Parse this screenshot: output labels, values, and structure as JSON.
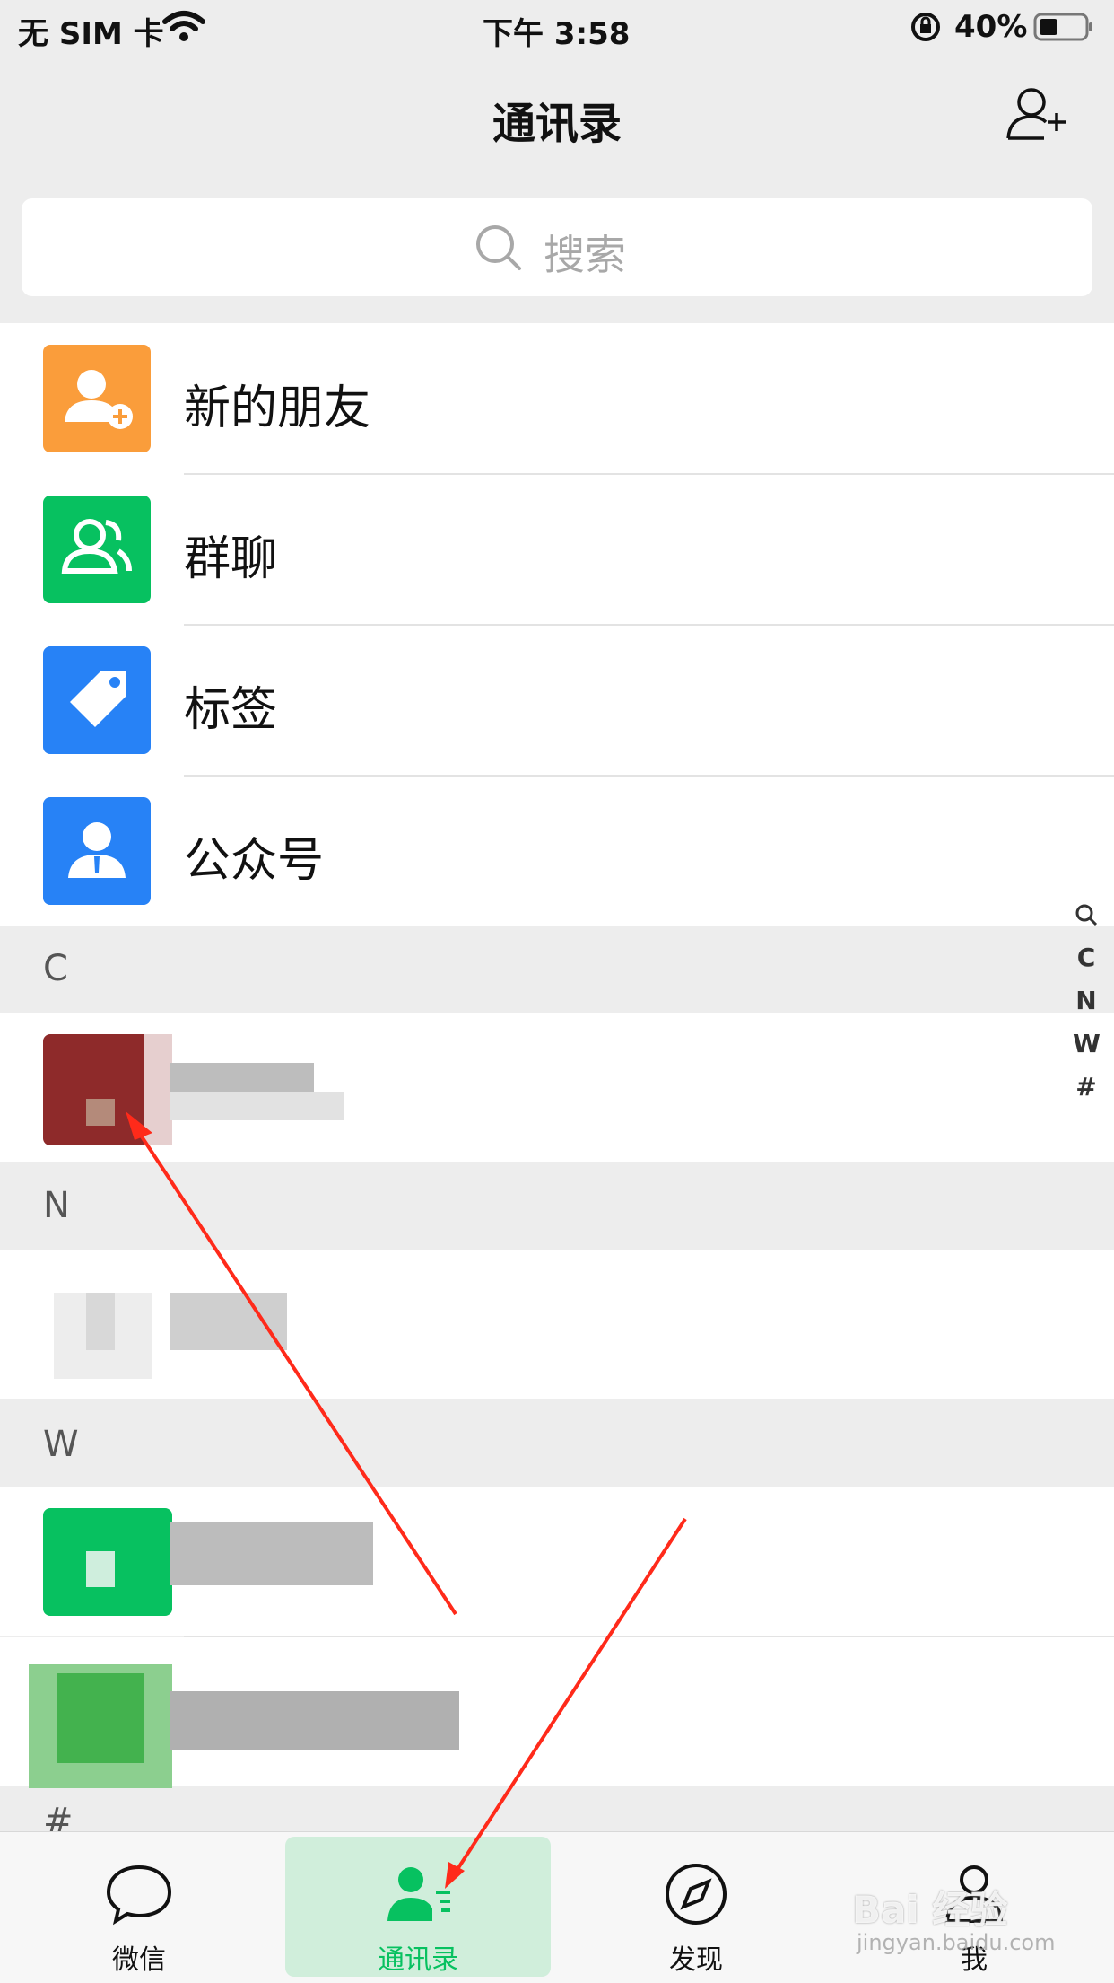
{
  "status_bar": {
    "carrier": "无 SIM 卡",
    "time": "下午 3:58",
    "battery": "40%"
  },
  "nav": {
    "title": "通讯录",
    "add_icon": "add-contact-icon"
  },
  "search": {
    "placeholder": "搜索"
  },
  "fixed_items": [
    {
      "label": "新的朋友",
      "icon": "new-friends-icon",
      "color": "#fa9d3b"
    },
    {
      "label": "群聊",
      "icon": "group-chat-icon",
      "color": "#07c160"
    },
    {
      "label": "标签",
      "icon": "tag-icon",
      "color": "#2782f6"
    },
    {
      "label": "公众号",
      "icon": "official-account-icon",
      "color": "#2782f6"
    }
  ],
  "sections": [
    {
      "letter": "C"
    },
    {
      "letter": "N"
    },
    {
      "letter": "W"
    },
    {
      "letter": "#"
    }
  ],
  "index_bar": [
    "C",
    "N",
    "W",
    "#"
  ],
  "tabs": [
    {
      "label": "微信",
      "icon": "chat-bubble-icon"
    },
    {
      "label": "通讯录",
      "icon": "contacts-icon"
    },
    {
      "label": "发现",
      "icon": "compass-icon"
    },
    {
      "label": "我",
      "icon": "me-icon"
    }
  ],
  "colors": {
    "accent_green": "#07c160",
    "annotation_red": "#ff2a1a"
  },
  "watermark": {
    "brand": "Bai 经验",
    "url": "jingyan.baidu.com"
  }
}
